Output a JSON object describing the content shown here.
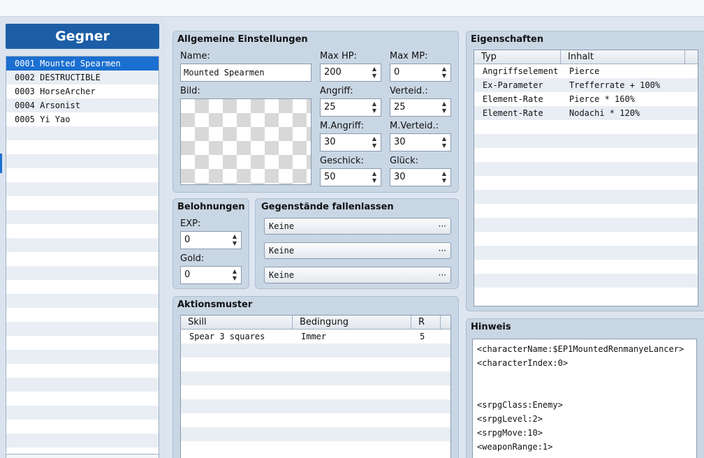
{
  "enemy_list": {
    "title": "Gegner",
    "items": [
      {
        "label": "0001 Mounted Spearmen",
        "selected": true
      },
      {
        "label": "0002 DESTRUCTIBLE",
        "selected": false
      },
      {
        "label": "0003 HorseArcher",
        "selected": false
      },
      {
        "label": "0004 Arsonist",
        "selected": false
      },
      {
        "label": "0005 Yi Yao",
        "selected": false
      }
    ]
  },
  "general": {
    "title": "Allgemeine Einstellungen",
    "name_label": "Name:",
    "name_value": "Mounted Spearmen",
    "image_label": "Bild:",
    "max_hp_label": "Max HP:",
    "max_hp": "200",
    "max_mp_label": "Max MP:",
    "max_mp": "0",
    "attack_label": "Angriff:",
    "attack": "25",
    "defense_label": "Verteid.:",
    "defense": "25",
    "m_attack_label": "M.Angriff:",
    "m_attack": "30",
    "m_defense_label": "M.Verteid.:",
    "m_defense": "30",
    "agility_label": "Geschick:",
    "agility": "50",
    "luck_label": "Glück:",
    "luck": "30"
  },
  "rewards": {
    "title": "Belohnungen",
    "exp_label": "EXP:",
    "exp": "0",
    "gold_label": "Gold:",
    "gold": "0"
  },
  "drops": {
    "title": "Gegenstände fallenlassen",
    "items": [
      "Keine",
      "Keine",
      "Keine"
    ],
    "button_glyph": "···"
  },
  "actions": {
    "title": "Aktionsmuster",
    "columns": [
      "Skill",
      "Bedingung",
      "R"
    ],
    "rows": [
      {
        "skill": "Spear 3 squares",
        "condition": "Immer",
        "rating": "5"
      }
    ]
  },
  "traits": {
    "title": "Eigenschaften",
    "columns": [
      "Typ",
      "Inhalt"
    ],
    "rows": [
      {
        "type": "Angriffselement",
        "content": "Pierce"
      },
      {
        "type": "Ex-Parameter",
        "content": "Trefferrate + 100%"
      },
      {
        "type": "Element-Rate",
        "content": "Pierce * 160%"
      },
      {
        "type": "Element-Rate",
        "content": "Nodachi * 120%"
      }
    ]
  },
  "note": {
    "title": "Hinweis",
    "lines": [
      "<characterName:$EP1MountedRenmanyeLancer>",
      "<characterIndex:0>",
      "",
      "",
      "<srpgClass:Enemy>",
      "<srpgLevel:2>",
      "<srpgMove:10>",
      "<weaponRange:1>"
    ]
  },
  "icons": {
    "spin_arrows": "▲▼",
    "dropdown": "ellipsis-icon"
  }
}
